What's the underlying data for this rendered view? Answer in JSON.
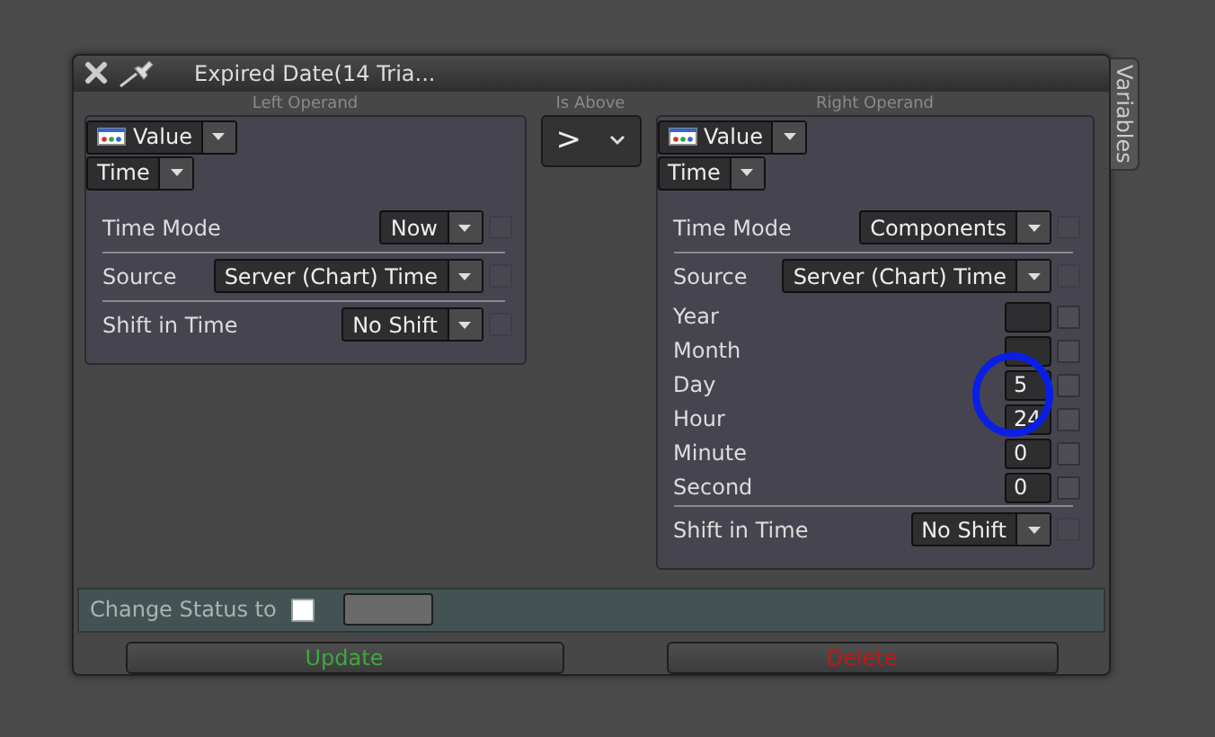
{
  "window": {
    "title": "Expired Date(14 Tria..."
  },
  "variables_tab": {
    "label": "Variables"
  },
  "left_operand": {
    "heading": "Left Operand",
    "value_type": "Value",
    "data_type": "Time",
    "rows": [
      {
        "kind": "select",
        "label": "Time Mode",
        "value": "Now",
        "checked": false
      },
      {
        "kind": "divider"
      },
      {
        "kind": "select",
        "label": "Source",
        "value": "Server (Chart) Time",
        "checked": false
      },
      {
        "kind": "divider"
      },
      {
        "kind": "select",
        "label": "Shift in Time",
        "value": "No Shift",
        "checked": false
      }
    ]
  },
  "operator": {
    "heading": "Is Above",
    "symbol": ">"
  },
  "right_operand": {
    "heading": "Right Operand",
    "value_type": "Value",
    "data_type": "Time",
    "rows": [
      {
        "kind": "select",
        "label": "Time Mode",
        "value": "Components",
        "checked": false
      },
      {
        "kind": "divider"
      },
      {
        "kind": "select",
        "label": "Source",
        "value": "Server (Chart) Time",
        "checked": false
      },
      {
        "kind": "number",
        "label": "Year",
        "checked": false
      },
      {
        "kind": "number",
        "label": "Month",
        "checked": false
      },
      {
        "kind": "number",
        "label": "Day",
        "value": "5",
        "checked": false
      },
      {
        "kind": "number",
        "label": "Hour",
        "value": "24",
        "checked": false
      },
      {
        "kind": "number",
        "label": "Minute",
        "value": "0",
        "checked": false
      },
      {
        "kind": "number",
        "label": "Second",
        "value": "0",
        "checked": false
      },
      {
        "kind": "divider"
      },
      {
        "kind": "select",
        "label": "Shift in Time",
        "value": "No Shift",
        "checked": false
      }
    ]
  },
  "status": {
    "label": "Change Status to",
    "checked": false
  },
  "buttons": [
    {
      "label": "Update",
      "kind": "update"
    },
    {
      "label": "Delete",
      "kind": "delete"
    }
  ]
}
